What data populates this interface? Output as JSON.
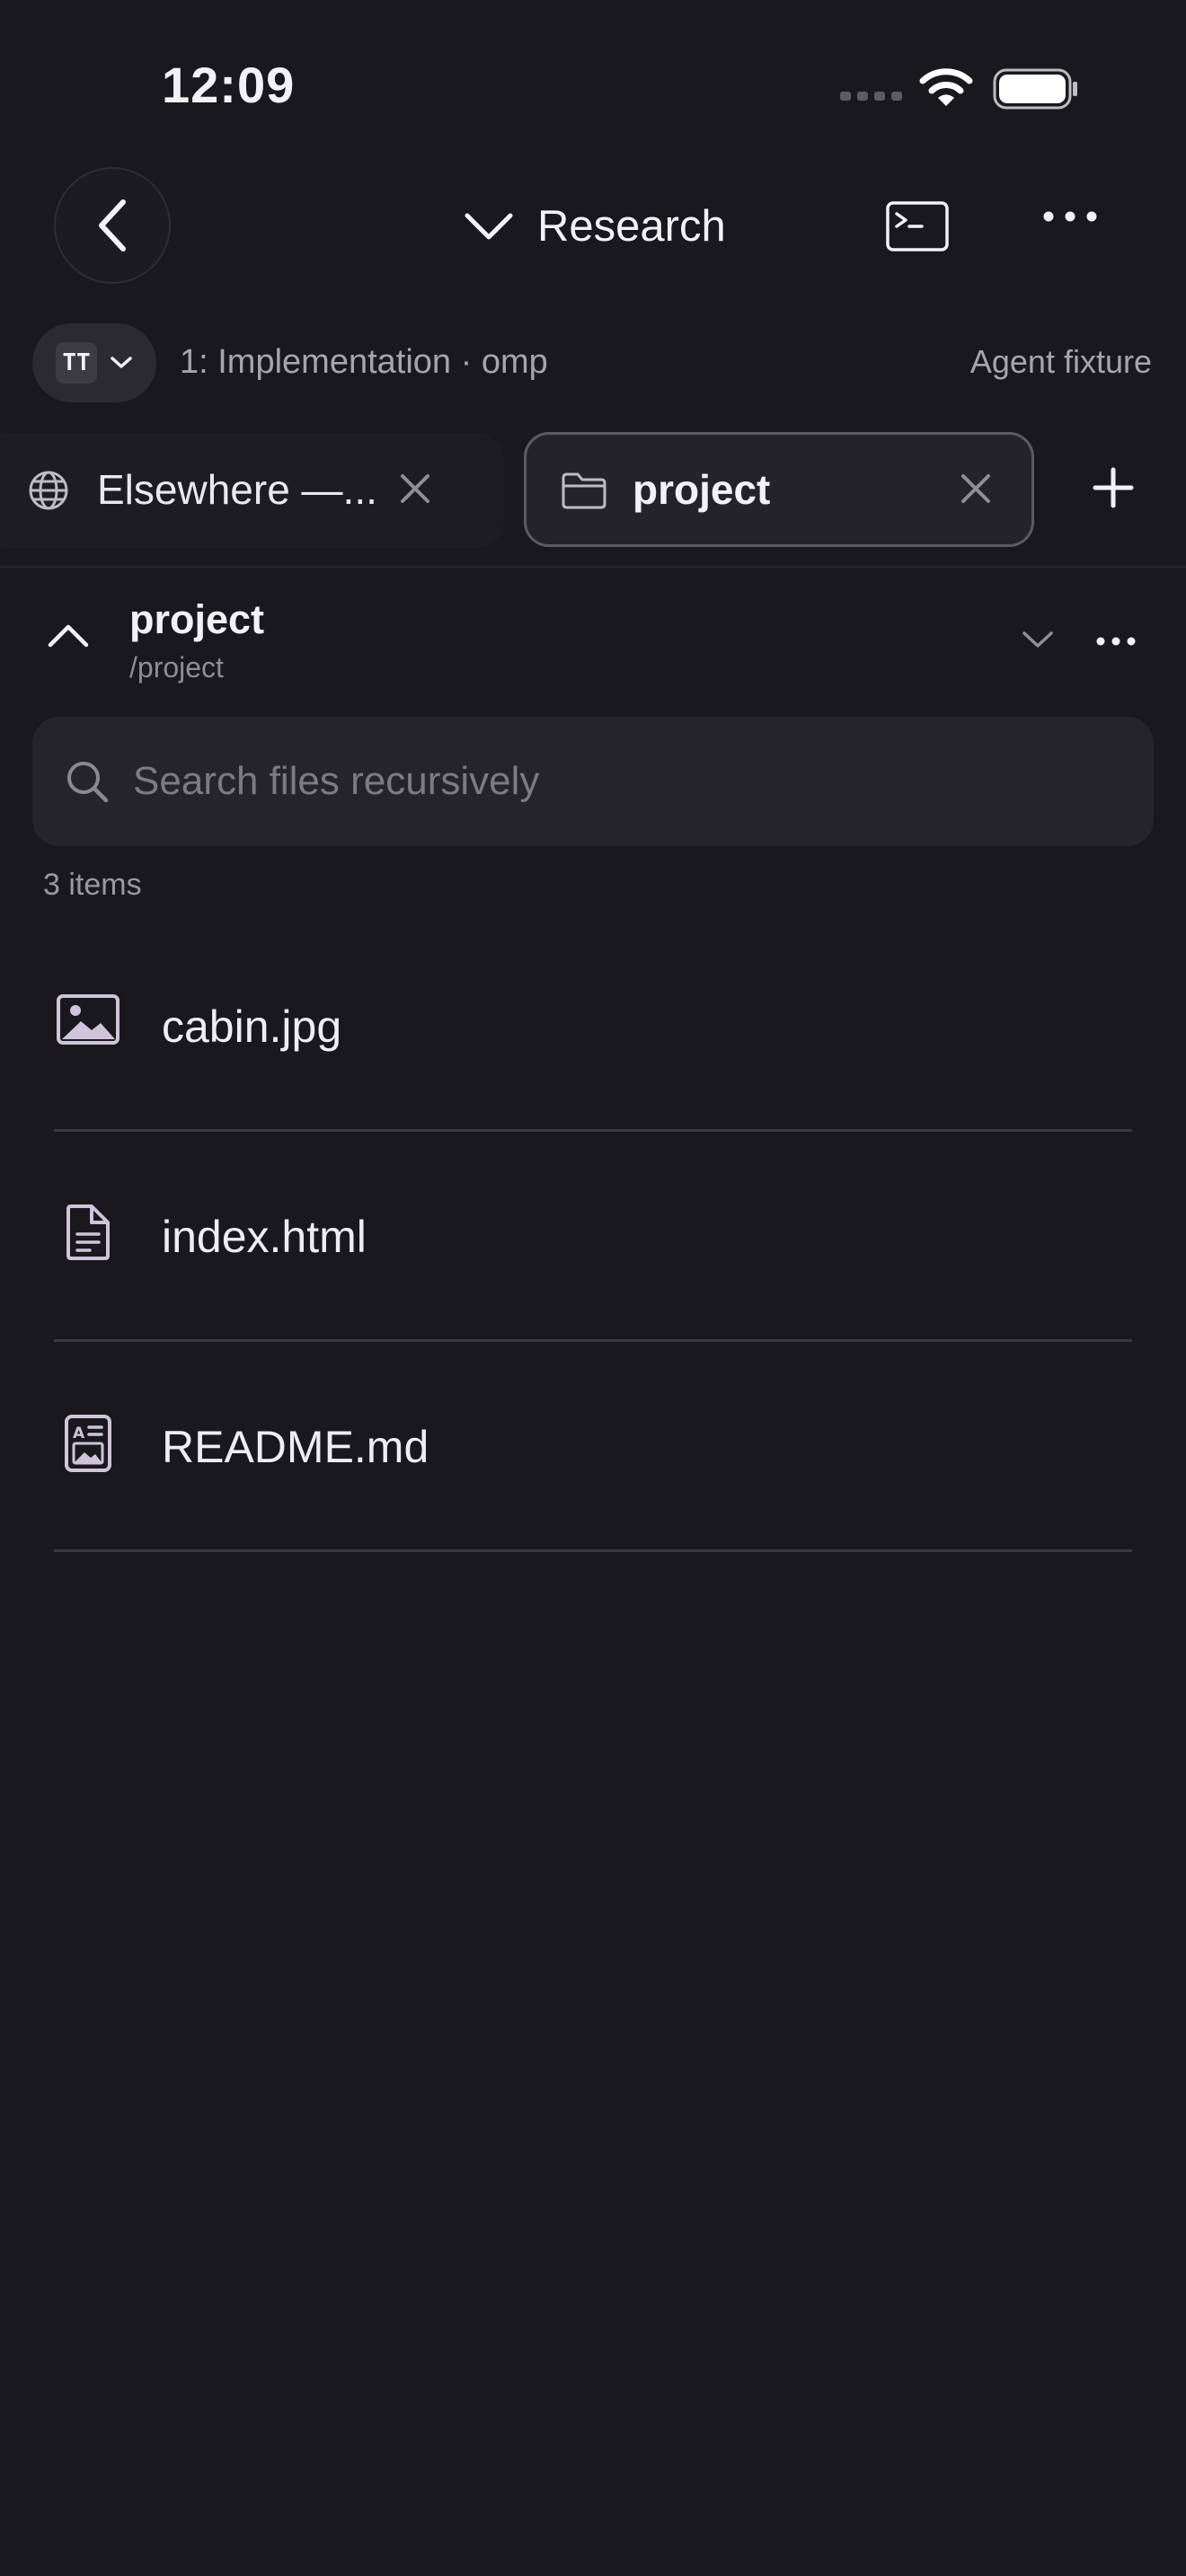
{
  "status_bar": {
    "time": "12:09"
  },
  "header": {
    "title": "Research"
  },
  "session": {
    "agent_logo": "TT",
    "label": "1: Implementation · omp",
    "right_label": "Agent fixture"
  },
  "tabs": [
    {
      "label": "Elsewhere —...",
      "icon": "globe-icon",
      "active": false
    },
    {
      "label": "project",
      "icon": "folder-icon",
      "active": true
    }
  ],
  "folder": {
    "name": "project",
    "path": "/project"
  },
  "search": {
    "placeholder": "Search files recursively",
    "value": ""
  },
  "item_count": "3 items",
  "files": [
    {
      "name": "cabin.jpg",
      "icon": "image-file-icon"
    },
    {
      "name": "index.html",
      "icon": "text-file-icon"
    },
    {
      "name": "README.md",
      "icon": "markdown-file-icon"
    }
  ],
  "colors": {
    "background": "#19181d",
    "surface": "#25242a",
    "text": "#f2f1f5",
    "muted": "#a6a4ad",
    "icon_accent": "#cfc4db"
  }
}
